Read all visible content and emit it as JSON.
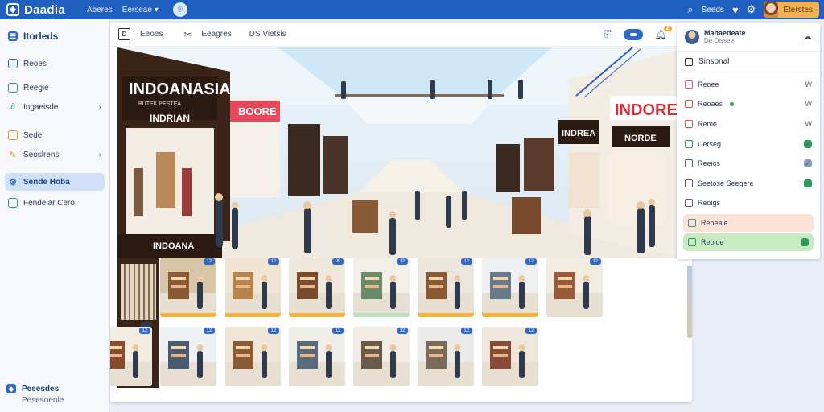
{
  "app": {
    "logo_text": "Daadia",
    "nav": [
      "Aberes",
      "Eerseae"
    ],
    "right_link": "Seeds",
    "user_name": "Eterstes"
  },
  "sidebar": {
    "title": "Itorleds",
    "items": [
      {
        "label": "Reoes",
        "icon": "square-icon"
      },
      {
        "label": "Reegie",
        "icon": "doc-icon"
      },
      {
        "label": "Ingaeisde",
        "icon": "link-icon",
        "chevron": true
      },
      {
        "label": "Sedel",
        "icon": "chat-icon"
      },
      {
        "label": "Seoslrens",
        "icon": "tag-icon",
        "chevron": true
      },
      {
        "label": "Sende Hoba",
        "icon": "gear-icon",
        "active": true
      },
      {
        "label": "Fendelar Cero",
        "icon": "grid-icon"
      }
    ],
    "footer": {
      "title": "Peeesdes",
      "subtitle": "Pesesoenle"
    }
  },
  "toolbar": {
    "box_label": "D",
    "tab1": "Eeoes",
    "tab2": "Eeagres",
    "tab3": "DS Vietsis",
    "notif_count": "2"
  },
  "hero": {
    "sign_main": "INDOANASIA",
    "sign_sub": "INDRIAN",
    "sign_small": "BUTEK PESTEA",
    "sign_pink": "BOORE",
    "sign_left_low": "INDOANA",
    "sign_right": "INDOREA",
    "sign_right2": "INDREA",
    "sign_right_small": "NORDE"
  },
  "thumbs": [
    {
      "badge": "12",
      "bar": "#f2b43a"
    },
    {
      "badge": "12",
      "bar": "#f2b43a"
    },
    {
      "badge": "09",
      "bar": "#f2b43a"
    },
    {
      "badge": "12",
      "bar": "#bfe0c0"
    },
    {
      "badge": "12",
      "bar": "#f2b43a"
    },
    {
      "badge": "12",
      "bar": "#f2b43a"
    },
    {
      "badge": "12",
      "bar": ""
    },
    {
      "badge": "12",
      "bar": ""
    },
    {
      "badge": "12",
      "bar": ""
    },
    {
      "badge": "12",
      "bar": ""
    },
    {
      "badge": "12",
      "bar": ""
    },
    {
      "badge": "12",
      "bar": ""
    },
    {
      "badge": "12",
      "bar": ""
    },
    {
      "badge": "12",
      "bar": ""
    }
  ],
  "panel": {
    "title": "Manaedeate",
    "subtitle": "De Dissee",
    "section": "Sinsonal",
    "rows": [
      {
        "label": "Reoee",
        "end": "W",
        "color": "#e0479a"
      },
      {
        "label": "Reoaes",
        "end": "W",
        "color": "#e24b3d",
        "dot": true
      },
      {
        "label": "Reme",
        "end": "W",
        "color": "#e24b3d"
      },
      {
        "label": "Uerseg",
        "end": "",
        "color": "#2a9d5a",
        "badge": "#2a9d5a"
      },
      {
        "label": "Reeios",
        "end": "",
        "color": "#55617a",
        "badge": "#8aa0c0"
      },
      {
        "label": "Seetose Seegere",
        "end": "",
        "color": "#55617a",
        "badge": "#2a9d5a"
      },
      {
        "label": "Reoigs",
        "end": "",
        "color": "#55617a"
      },
      {
        "label": "Reoeaie",
        "end": "",
        "color": "#2a9aa0",
        "highlight": "orange"
      },
      {
        "label": "Reoioe",
        "end": "",
        "color": "#2a9d5a",
        "highlight": "green",
        "badge": "#2a9d5a"
      }
    ]
  }
}
